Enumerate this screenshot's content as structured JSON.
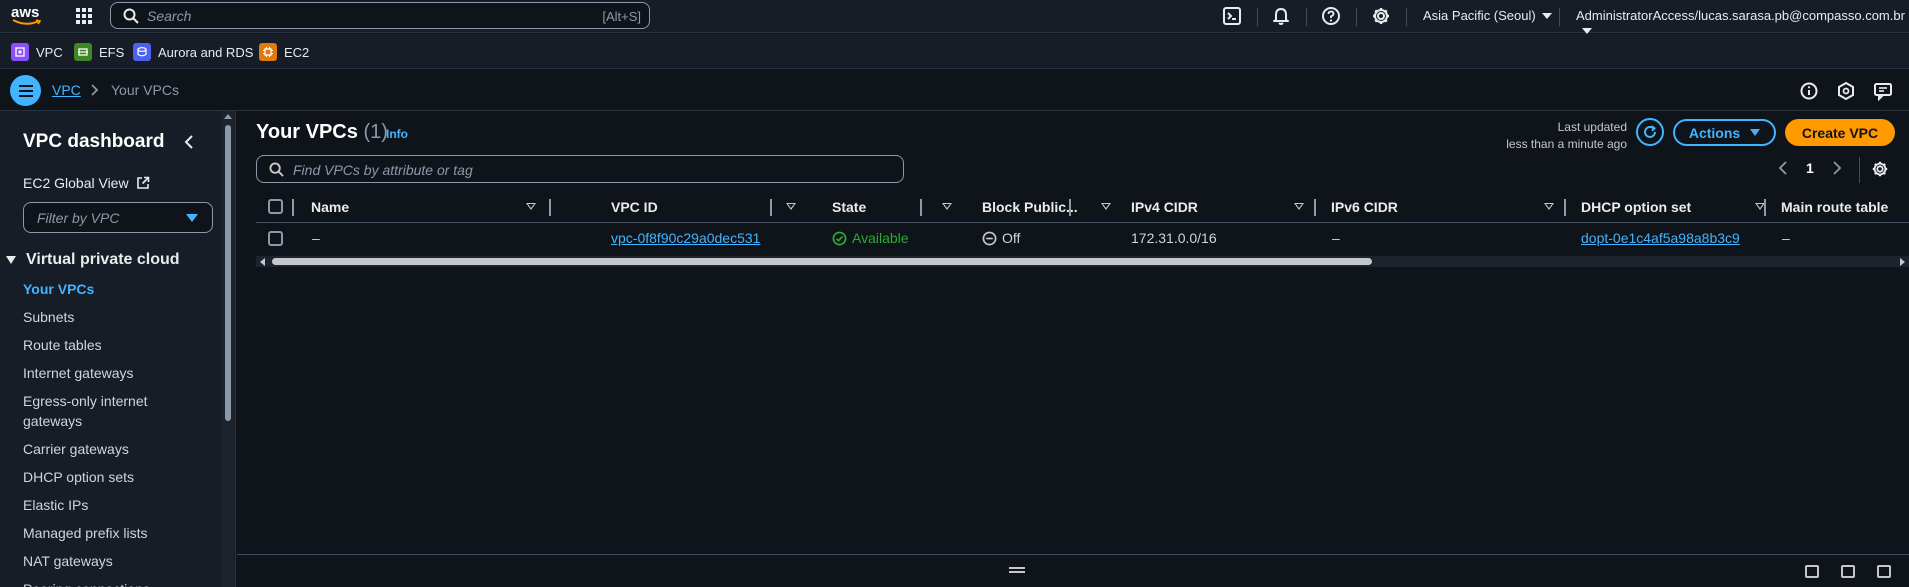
{
  "topnav": {
    "logo_text": "aws",
    "search_placeholder": "Search",
    "search_shortcut": "[Alt+S]",
    "region": "Asia Pacific (Seoul)",
    "account": "AdministratorAccess/lucas.sarasa.pb@compasso.com.br"
  },
  "favorites": [
    {
      "label": "VPC",
      "color": "#8c4fff"
    },
    {
      "label": "EFS",
      "color": "#3f8624"
    },
    {
      "label": "Aurora and RDS",
      "color": "#4d61f0"
    },
    {
      "label": "EC2",
      "color": "#e07a0f"
    }
  ],
  "breadcrumb": {
    "root": "VPC",
    "current": "Your VPCs"
  },
  "sidebar": {
    "title": "VPC dashboard",
    "ec2_global_view": "EC2 Global View",
    "filter_placeholder": "Filter by VPC",
    "section": "Virtual private cloud",
    "items": [
      {
        "label": "Your VPCs"
      },
      {
        "label": "Subnets"
      },
      {
        "label": "Route tables"
      },
      {
        "label": "Internet gateways"
      },
      {
        "label": "Egress-only internet gateways"
      },
      {
        "label": "Carrier gateways"
      },
      {
        "label": "DHCP option sets"
      },
      {
        "label": "Elastic IPs"
      },
      {
        "label": "Managed prefix lists"
      },
      {
        "label": "NAT gateways"
      },
      {
        "label": "Peering connections"
      }
    ]
  },
  "main": {
    "title": "Your VPCs",
    "count": "(1)",
    "info": "Info",
    "last_updated_label": "Last updated",
    "last_updated_value": "less than a minute ago",
    "actions_label": "Actions",
    "create_label": "Create VPC",
    "search_placeholder": "Find VPCs by attribute or tag",
    "page": "1",
    "columns": [
      "Name",
      "VPC ID",
      "State",
      "Block Public...",
      "IPv4 CIDR",
      "IPv6 CIDR",
      "DHCP option set",
      "Main route table"
    ],
    "rows": [
      {
        "name": "–",
        "vpc_id": "vpc-0f8f90c29a0dec531",
        "state": "Available",
        "block_public": "Off",
        "ipv4": "172.31.0.0/16",
        "ipv6": "–",
        "dhcp": "dopt-0e1c4af5a98a8b3c9",
        "main_route": "–"
      }
    ]
  },
  "colors": {
    "accent": "#42b4ff",
    "primary_button": "#ff9900",
    "status_ok": "#29ad32"
  }
}
